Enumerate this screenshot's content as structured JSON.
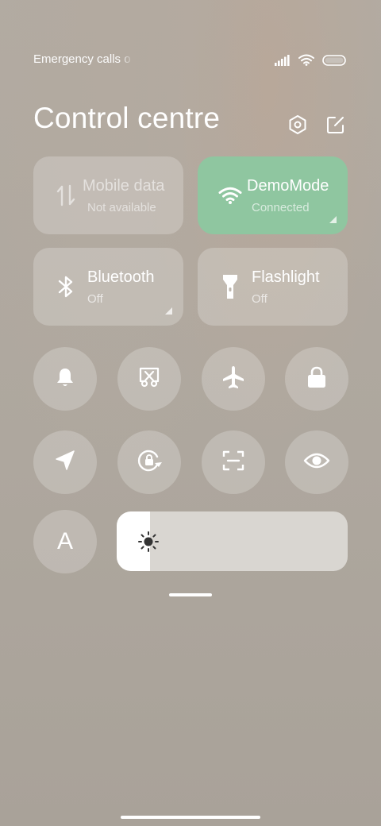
{
  "status_bar": {
    "carrier_text": "Emergency calls o",
    "icons": [
      "signal-icon",
      "wifi-icon",
      "battery-icon"
    ]
  },
  "header": {
    "title": "Control centre",
    "actions": [
      "settings-icon",
      "edit-icon"
    ]
  },
  "tiles": [
    {
      "name": "mobile-data",
      "title": "Mobile data",
      "subtitle": "Not available",
      "icon": "mobile-data-icon",
      "state": "disabled"
    },
    {
      "name": "wifi",
      "title": "DemoMode",
      "subtitle": "Connected",
      "icon": "wifi-icon",
      "state": "on"
    },
    {
      "name": "bluetooth",
      "title": "Bluetooth",
      "subtitle": "Off",
      "icon": "bluetooth-icon",
      "state": "off"
    },
    {
      "name": "flashlight",
      "title": "Flashlight",
      "subtitle": "Off",
      "icon": "flashlight-icon",
      "state": "off"
    }
  ],
  "toggles": [
    "bell-icon",
    "screenshot-icon",
    "airplane-icon",
    "lock-icon",
    "location-icon",
    "rotation-lock-icon",
    "scan-icon",
    "eye-icon"
  ],
  "font_toggle": {
    "label": "A"
  },
  "brightness": {
    "level_fraction": 0.145,
    "icon": "sun-icon"
  },
  "colors": {
    "wifi_active": "#8fc6a0",
    "tile_bg": "rgba(255,255,255,0.22)"
  }
}
